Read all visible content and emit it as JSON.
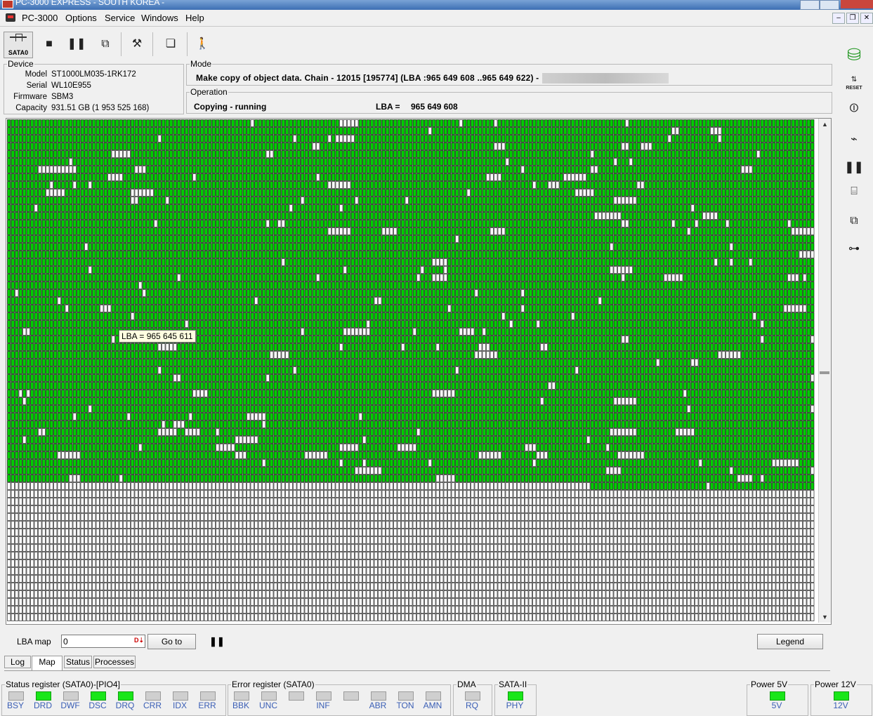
{
  "window": {
    "title": "PC-3000 EXPRESS - SOUTH KOREA -"
  },
  "menu": {
    "app_label": "PC-3000",
    "items": [
      "Options",
      "Service",
      "Windows",
      "Help"
    ]
  },
  "toolbar": {
    "port_label": "SATA0",
    "icons": [
      "stop-icon",
      "pause-icon",
      "export-icon",
      "tools-icon",
      "windows-icon",
      "disabled-person-icon"
    ]
  },
  "device": {
    "legend": "Device",
    "model_label": "Model",
    "model": "ST1000LM035-1RK172",
    "serial_label": "Serial",
    "serial": "WL10E955",
    "firmware_label": "Firmware",
    "firmware": "SBM3",
    "capacity_label": "Capacity",
    "capacity": "931.51 GB (1 953 525 168)"
  },
  "mode": {
    "legend": "Mode",
    "text": "Make copy of object data. Chain - 12015 [195774] (LBA :965 649 608 ..965 649 622) -"
  },
  "operation": {
    "legend": "Operation",
    "status": "Copying - running",
    "lba_label": "LBA =",
    "lba_value": "965 649 608"
  },
  "map": {
    "tooltip": "LBA =  965 645 611",
    "colors": {
      "read": "#00cc00",
      "pending": "#ffffff",
      "border": "#000000"
    }
  },
  "lba_bar": {
    "label": "LBA map",
    "input_value": "0",
    "goto_label": "Go to",
    "legend_label": "Legend"
  },
  "tabs": [
    "Log",
    "Map",
    "Status",
    "Processes"
  ],
  "active_tab": "Map",
  "status_register": {
    "legend": "Status register (SATA0)-[PIO4]",
    "leds": [
      {
        "name": "BSY",
        "on": false
      },
      {
        "name": "DRD",
        "on": true
      },
      {
        "name": "DWF",
        "on": false
      },
      {
        "name": "DSC",
        "on": true
      },
      {
        "name": "DRQ",
        "on": true
      },
      {
        "name": "CRR",
        "on": false
      },
      {
        "name": "IDX",
        "on": false
      },
      {
        "name": "ERR",
        "on": false
      }
    ]
  },
  "error_register": {
    "legend": "Error register (SATA0)",
    "leds": [
      {
        "name": "BBK",
        "on": false
      },
      {
        "name": "UNC",
        "on": false
      },
      {
        "name": "",
        "on": false
      },
      {
        "name": "INF",
        "on": false
      },
      {
        "name": "",
        "on": false
      },
      {
        "name": "ABR",
        "on": false
      },
      {
        "name": "TON",
        "on": false
      },
      {
        "name": "AMN",
        "on": false
      }
    ]
  },
  "dma": {
    "legend": "DMA",
    "led": "RQ",
    "on": false
  },
  "sata2": {
    "legend": "SATA-II",
    "led": "PHY",
    "on": true
  },
  "power5": {
    "legend": "Power 5V",
    "led": "5V",
    "on": true
  },
  "power12": {
    "legend": "Power 12V",
    "led": "12V",
    "on": true
  }
}
